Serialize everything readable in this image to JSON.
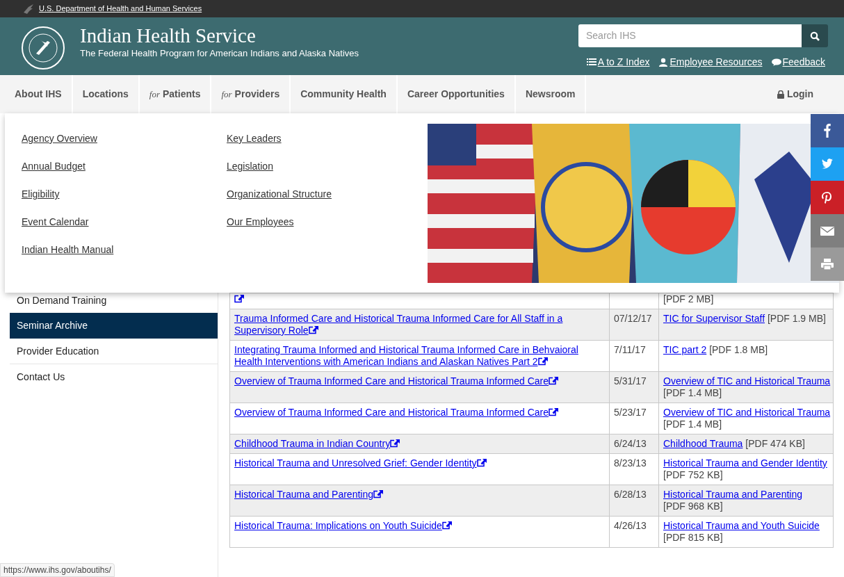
{
  "gov_bar": {
    "link": "U.S. Department of Health and Human Services"
  },
  "header": {
    "title": "Indian Health Service",
    "subtitle": "The Federal Health Program for American Indians and Alaska Natives",
    "search": {
      "placeholder": "Search IHS"
    },
    "links": [
      {
        "kind": "list",
        "label": "A to Z Index"
      },
      {
        "kind": "user",
        "label": "Employee Resources"
      },
      {
        "kind": "comment",
        "label": "Feedback"
      }
    ]
  },
  "nav": {
    "items": [
      {
        "label": "About IHS"
      },
      {
        "label": "Locations"
      },
      {
        "prefix": "for",
        "label": "Patients"
      },
      {
        "prefix": "for",
        "label": "Providers"
      },
      {
        "label": "Community Health"
      },
      {
        "label": "Career Opportunities"
      },
      {
        "label": "Newsroom"
      }
    ],
    "login": "Login"
  },
  "dropdown": {
    "columns": [
      [
        "Agency Overview",
        "Annual Budget",
        "Eligibility",
        "Event Calendar",
        "Indian Health Manual"
      ],
      [
        "Key Leaders",
        "Legislation",
        "Organizational Structure",
        "Our Employees"
      ]
    ],
    "image": {
      "kind": "picture"
    }
  },
  "share_buttons": [
    {
      "kind": "facebook",
      "color": "#3b5998"
    },
    {
      "kind": "twitter",
      "color": "#1da1f2"
    },
    {
      "kind": "pinterest",
      "color": "#cb2027"
    },
    {
      "kind": "email",
      "color": "#7f7f7f"
    },
    {
      "kind": "print",
      "color": "#9a9a9a"
    }
  ],
  "sidebar": {
    "items": [
      {
        "label": "On Demand Training",
        "selected": false
      },
      {
        "label": "Seminar Archive",
        "selected": true
      },
      {
        "label": "Provider Education",
        "selected": false
      },
      {
        "label": "Contact Us",
        "selected": false
      }
    ]
  },
  "table": {
    "rows": [
      {
        "external": true,
        "file_size": "[PDF 2 MB]"
      },
      {
        "title": "Trauma Informed Care and Historical Trauma Informed Care for All Staff in a Supervisory Role",
        "external": true,
        "date": "07/12/17",
        "file_link": "TIC for Supervisor Staff",
        "file_size": "[PDF 1.9 MB]"
      },
      {
        "title": "Integrating Trauma Informed and Historical Trauma Informed Care in Behvaioral Health Interventions with American Indians and Alaskan Natives Part 2",
        "external": true,
        "date": "7/11/17",
        "file_link": "TIC part 2",
        "file_size": "[PDF 1.8 MB]"
      },
      {
        "title": "Overview of Trauma Informed Care and Historical Trauma Informed Care",
        "external": true,
        "date": "5/31/17",
        "file_link": "Overview of TIC and Historical Trauma",
        "file_size": "[PDF 1.4 MB]"
      },
      {
        "title": "Overview of Trauma Informed Care and Historical Trauma Informed Care",
        "external": true,
        "date": "5/23/17",
        "file_link": "Overview of TIC and Historical Trauma",
        "file_size": "[PDF 1.4 MB]"
      },
      {
        "title": "Childhood Trauma in Indian Country",
        "external": true,
        "date": "6/24/13",
        "file_link": "Childhood Trauma",
        "file_size": "[PDF 474 KB]"
      },
      {
        "title": "Historical Trauma and Unresolved Grief: Gender Identity",
        "external": true,
        "date": "8/23/13",
        "file_link": "Historical Trauma and Gender Identity",
        "file_size": "[PDF 752 KB]"
      },
      {
        "title": "Historical Trauma and Parenting",
        "external": true,
        "date": "6/28/13",
        "file_link": "Historical Trauma and Parenting",
        "file_size": "[PDF 968 KB]"
      },
      {
        "title": "Historical Trauma: Implications on Youth Suicide",
        "external": true,
        "date": "4/26/13",
        "file_link": "Historical Trauma and Youth Suicide",
        "file_size": "[PDF 815 KB]"
      }
    ]
  },
  "status_url": "https://www.ihs.gov/aboutihs/"
}
